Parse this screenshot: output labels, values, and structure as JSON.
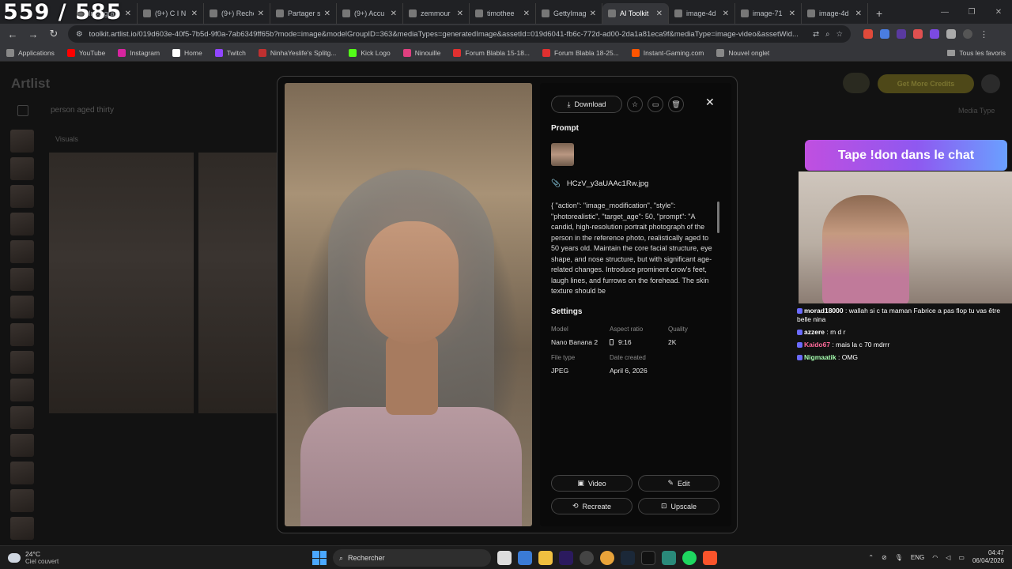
{
  "stream_counter": "559 / 585",
  "tabs": [
    {
      "label": "Instagram",
      "active": false
    },
    {
      "label": "(9+) C I N",
      "active": false
    },
    {
      "label": "(9+) Reche",
      "active": false
    },
    {
      "label": "Partager s",
      "active": false
    },
    {
      "label": "(9+) Accu",
      "active": false
    },
    {
      "label": "zemmour",
      "active": false
    },
    {
      "label": "timothee",
      "active": false
    },
    {
      "label": "GettyImag",
      "active": false
    },
    {
      "label": "AI Toolkit",
      "active": true
    },
    {
      "label": "image-4d",
      "active": false
    },
    {
      "label": "image-71",
      "active": false
    },
    {
      "label": "image-4d",
      "active": false
    }
  ],
  "url": "toolkit.artlist.io/019d603e-40f5-7b5d-9f0a-7ab6349ff65b?mode=image&modelGroupID=363&mediaTypes=generatedImage&assetId=019d6041-fb6c-772d-ad00-2da1a81eca9f&mediaType=image-video&assetWid...",
  "bookmarks": [
    "Applications",
    "YouTube",
    "Instagram",
    "Home",
    "Twitch",
    "NinhaYeslife's Splitg...",
    "Kick Logo",
    "Ninouille",
    "Forum Blabla 15-18...",
    "Forum Blabla 18-25...",
    "Instant-Gaming.com",
    "Nouvel onglet"
  ],
  "bookmarks_right": "Tous les favoris",
  "app": {
    "logo": "Artlist",
    "search_text": "person aged thirty",
    "visuals_label": "Visuals",
    "credits_button": "Get More Credits",
    "media_type": "Media Type"
  },
  "modal": {
    "download_label": "Download",
    "prompt_heading": "Prompt",
    "filename": "HCzV_y3aUAAc1Rw.jpg",
    "prompt_text": "{ \"action\": \"image_modification\", \"style\": \"photorealistic\", \"target_age\": 50, \"prompt\": \"A candid, high-resolution portrait photograph of the person in the reference photo, realistically aged to 50 years old. Maintain the core facial structure, eye shape, and nose structure, but with significant age-related changes. Introduce prominent crow's feet, laugh lines, and furrows on the forehead. The skin texture should be",
    "settings_heading": "Settings",
    "settings": {
      "model_label": "Model",
      "model_value": "Nano Banana 2",
      "aspect_label": "Aspect ratio",
      "aspect_value": "9:16",
      "quality_label": "Quality",
      "quality_value": "2K",
      "filetype_label": "File type",
      "filetype_value": "JPEG",
      "date_label": "Date created",
      "date_value": "April 6, 2026"
    },
    "actions": {
      "video": "Video",
      "edit": "Edit",
      "recreate": "Recreate",
      "upscale": "Upscale"
    }
  },
  "overlay": {
    "banner": "Tape !don dans le chat",
    "chat": [
      {
        "user": "morad18000",
        "msg": "wallah si c ta maman Fabrice a pas flop tu vas être belle nina",
        "color": "#ffffff"
      },
      {
        "user": "azzere",
        "msg": "m d r",
        "color": "#ffffff"
      },
      {
        "user": "Kaido67",
        "msg": "mais la c 70 mdrrr",
        "color": "#ff6a9a"
      },
      {
        "user": "Nigmaatik",
        "msg": "OMG",
        "color": "#a6ffb0"
      }
    ]
  },
  "taskbar": {
    "temp": "24°C",
    "weather": "Ciel couvert",
    "search_placeholder": "Rechercher",
    "lang": "ENG",
    "time": "04:47",
    "date": "06/04/2026"
  }
}
